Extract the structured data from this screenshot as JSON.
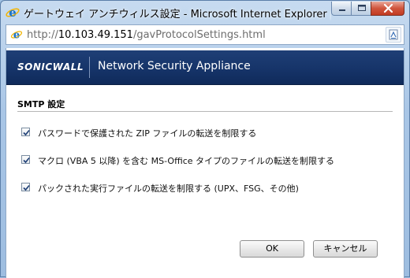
{
  "window": {
    "title": "ゲートウェイ アンチウィルス設定 - Microsoft Internet Explorer p..."
  },
  "address": {
    "url_prefix": "http://",
    "url_host": "10.103.49.151",
    "url_path": "/gavProtocolSettings.html"
  },
  "brand": {
    "logo": "SONICWALL",
    "product": "Network Security Appliance"
  },
  "section": {
    "title": "SMTP 設定"
  },
  "options": [
    {
      "label": "パスワードで保護された ZIP ファイルの転送を制限する",
      "checked": true
    },
    {
      "label": "マクロ (VBA 5 以降) を含む MS-Office タイプのファイルの転送を制限する",
      "checked": true
    },
    {
      "label": "パックされた実行ファイルの転送を制限する (UPX、FSG、その他)",
      "checked": true
    }
  ],
  "buttons": {
    "ok": "OK",
    "cancel": "キャンセル"
  },
  "icons": {
    "browser": "ie-icon",
    "page": "page-icon",
    "compat": "compatibility-view-icon"
  }
}
